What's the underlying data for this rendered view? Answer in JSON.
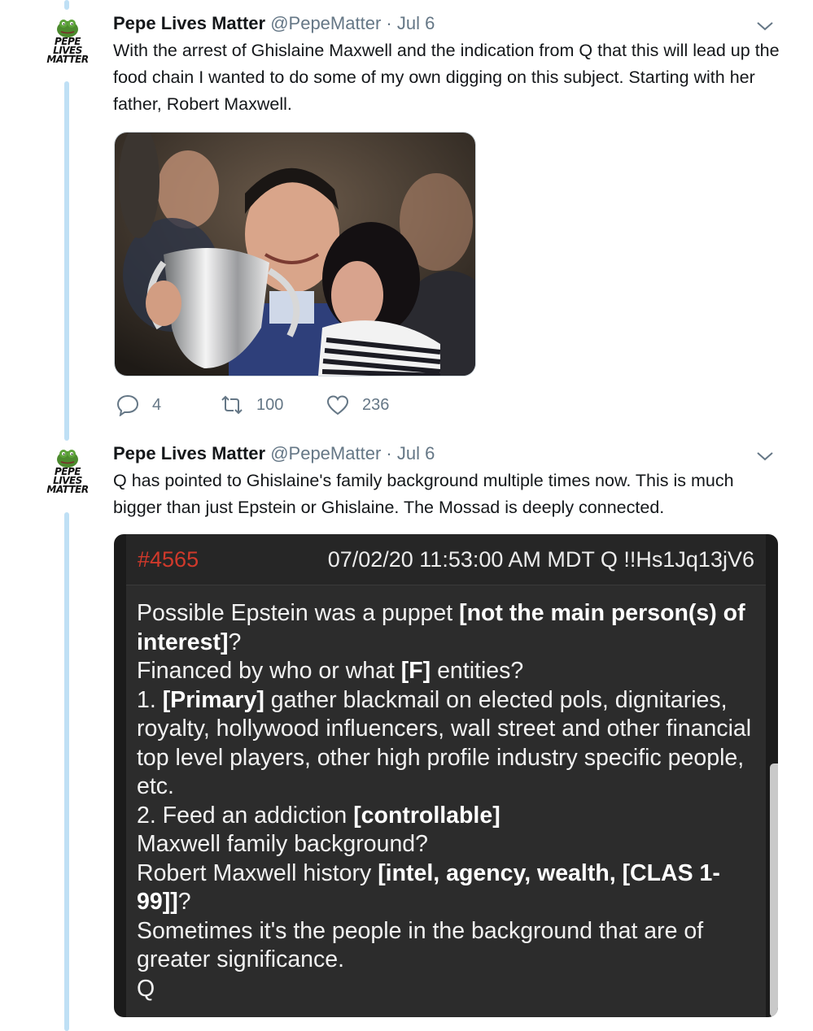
{
  "tweets": [
    {
      "avatar": {
        "logo_line1": "PEPE",
        "logo_line2": "LIVES",
        "logo_line3": "MATTER"
      },
      "name": "Pepe Lives Matter",
      "handle": "@PepeMatter",
      "separator": "·",
      "date": "Jul 6",
      "text": "With the arrest of Ghislaine Maxwell and the indication from Q that this will lead up the food chain I wanted to do some of my own digging on this subject. Starting with her father, Robert Maxwell.",
      "actions": {
        "replies": "4",
        "retweets": "100",
        "likes": "236"
      }
    },
    {
      "avatar": {
        "logo_line1": "PEPE",
        "logo_line2": "LIVES",
        "logo_line3": "MATTER"
      },
      "name": "Pepe Lives Matter",
      "handle": "@PepeMatter",
      "separator": "·",
      "date": "Jul 6",
      "text": "Q has pointed to Ghislaine's family background multiple times now. This is much bigger than just Epstein or Ghislaine. The Mossad is deeply connected."
    }
  ],
  "qpost": {
    "number": "#4565",
    "meta": "07/02/20 11:53:00 AM MDT Q !!Hs1Jq13jV6",
    "l1a": "Possible Epstein was a puppet ",
    "l1b": "[not the main person(s) of interest]",
    "l1c": "?",
    "l2a": "Financed by who or what ",
    "l2b": "[F]",
    "l2c": " entities?",
    "l3a": "1. ",
    "l3b": "[Primary]",
    "l3c": " gather blackmail on elected pols, dignitaries, royalty, hollywood influencers, wall street and other financial top level players, other high profile industry specific people, etc.",
    "l4a": "2. Feed an addiction ",
    "l4b": "[controllable]",
    "l5": "Maxwell family background?",
    "l6a": "Robert Maxwell history ",
    "l6b": "[intel, agency, wealth, [CLAS 1-99]]",
    "l6c": "?",
    "l7": "Sometimes it's the people in the background that are of greater significance.",
    "l8": "Q"
  },
  "colors": {
    "thread_line": "#bfe0f5",
    "secondary_text": "#657786",
    "qpost_number": "#d0392b",
    "qpost_bg": "#2c2c2c"
  },
  "icons": [
    "frog-avatar-icon",
    "chevron-down-icon",
    "reply-icon",
    "retweet-icon",
    "like-icon"
  ]
}
